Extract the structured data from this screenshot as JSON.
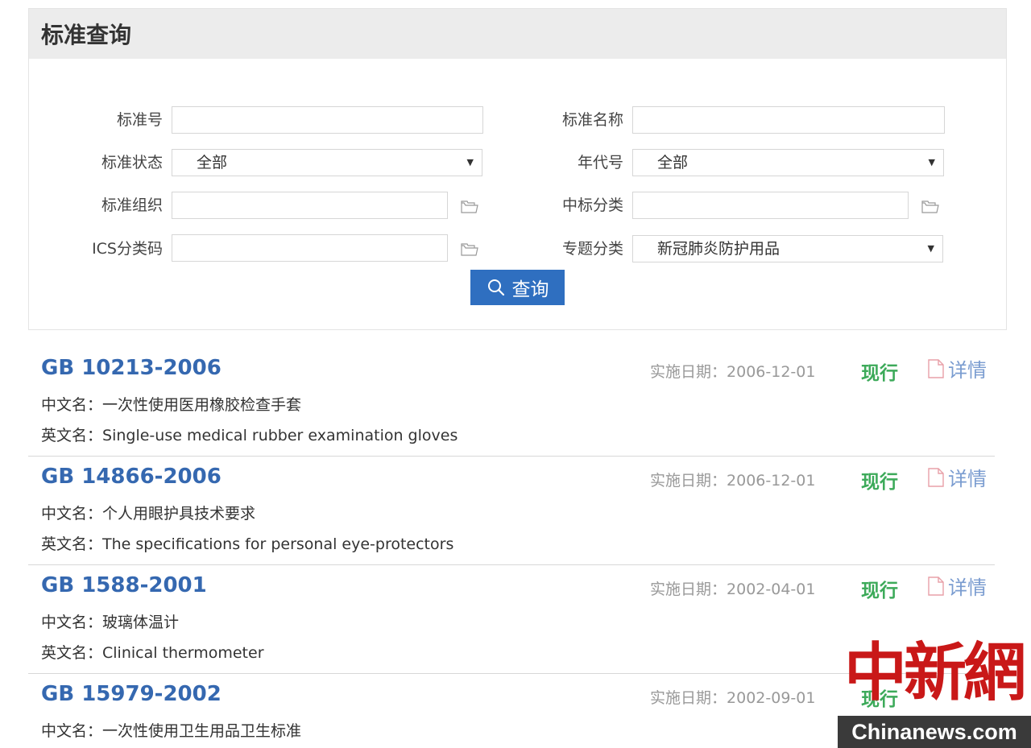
{
  "panel": {
    "title": "标准查询",
    "fields": {
      "standard_no": {
        "label": "标准号",
        "value": ""
      },
      "standard_name": {
        "label": "标准名称",
        "value": ""
      },
      "status": {
        "label": "标准状态",
        "selected": "全部"
      },
      "year": {
        "label": "年代号",
        "selected": "全部"
      },
      "org": {
        "label": "标准组织",
        "value": ""
      },
      "ccs": {
        "label": "中标分类",
        "value": ""
      },
      "ics": {
        "label": "ICS分类码",
        "value": ""
      },
      "topic": {
        "label": "专题分类",
        "selected": "新冠肺炎防护用品"
      }
    },
    "search_button": "查询"
  },
  "results": [
    {
      "code": "GB 10213-2006",
      "date_label": "实施日期：",
      "date": "2006-12-01",
      "status": "现行",
      "detail": "详情",
      "cn_label": "中文名：",
      "cn_name": "一次性使用医用橡胶检查手套",
      "en_label": "英文名：",
      "en_name": "Single-use medical rubber examination gloves"
    },
    {
      "code": "GB 14866-2006",
      "date_label": "实施日期：",
      "date": "2006-12-01",
      "status": "现行",
      "detail": "详情",
      "cn_label": "中文名：",
      "cn_name": "个人用眼护具技术要求",
      "en_label": "英文名：",
      "en_name": "The specifications for personal eye-protectors"
    },
    {
      "code": "GB 1588-2001",
      "date_label": "实施日期：",
      "date": "2002-04-01",
      "status": "现行",
      "detail": "详情",
      "cn_label": "中文名：",
      "cn_name": "玻璃体温计",
      "en_label": "英文名：",
      "en_name": "Clinical thermometer"
    },
    {
      "code": "GB 15979-2002",
      "date_label": "实施日期：",
      "date": "2002-09-01",
      "status": "现行",
      "detail": "",
      "cn_label": "中文名：",
      "cn_name": "一次性使用卫生用品卫生标准",
      "en_label": "",
      "en_name": ""
    }
  ],
  "watermark": {
    "cn": "中新網",
    "en": "Chinanews.com"
  },
  "colors": {
    "link": "#3568b0",
    "status": "#3daa5a",
    "button": "#2f6fc0",
    "header_bg": "#ececec"
  }
}
